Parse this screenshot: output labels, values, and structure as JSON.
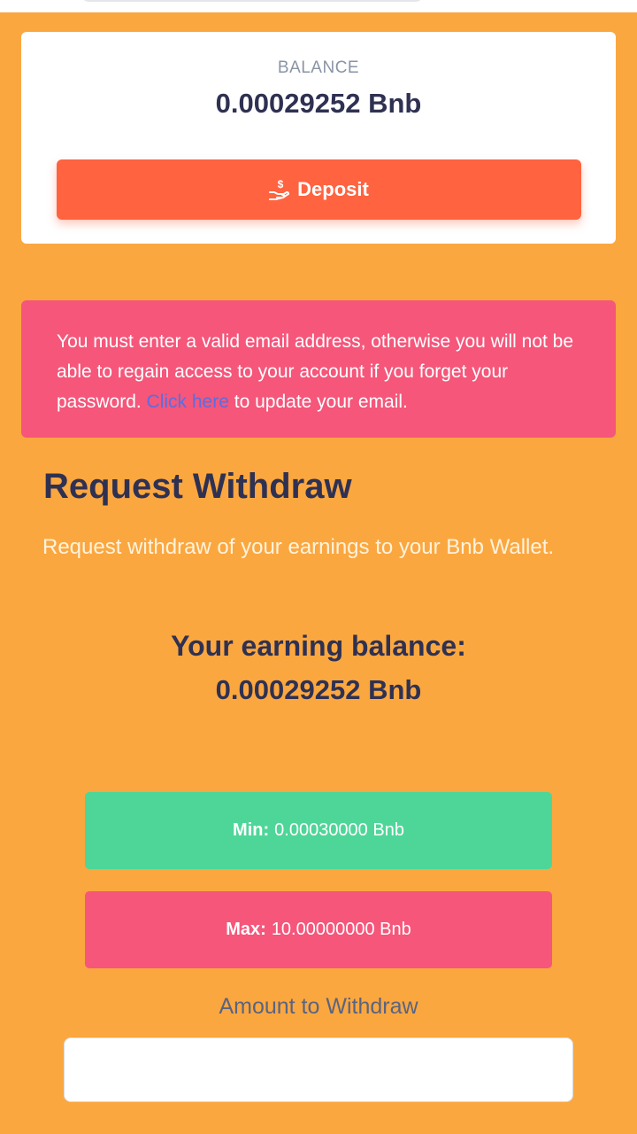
{
  "balance_card": {
    "label": "BALANCE",
    "value": "0.00029252 Bnb",
    "deposit_label": "Deposit",
    "deposit_icon": "hand-coin-icon"
  },
  "alert": {
    "text_before": "You must enter a valid email address, otherwise you will not be able to regain access to your account if you forget your password. ",
    "link_text": "Click here",
    "text_after": " to update your email."
  },
  "withdraw": {
    "heading": "Request Withdraw",
    "description": "Request withdraw of your earnings to your Bnb Wallet.",
    "earning_title": "Your earning balance:",
    "earning_value": "0.00029252 Bnb",
    "min_label": "Min:",
    "min_value": "0.00030000 Bnb",
    "max_label": "Max:",
    "max_value": "10.00000000 Bnb",
    "amount_label": "Amount to Withdraw",
    "amount_value": ""
  },
  "colors": {
    "page_background": "#FBA740",
    "deposit_button": "#FF6340",
    "alert_background": "#F5567A",
    "min_background": "#4ED698",
    "max_background": "#F5567A",
    "heading_text": "#2f3152",
    "link": "#5b6de0"
  }
}
